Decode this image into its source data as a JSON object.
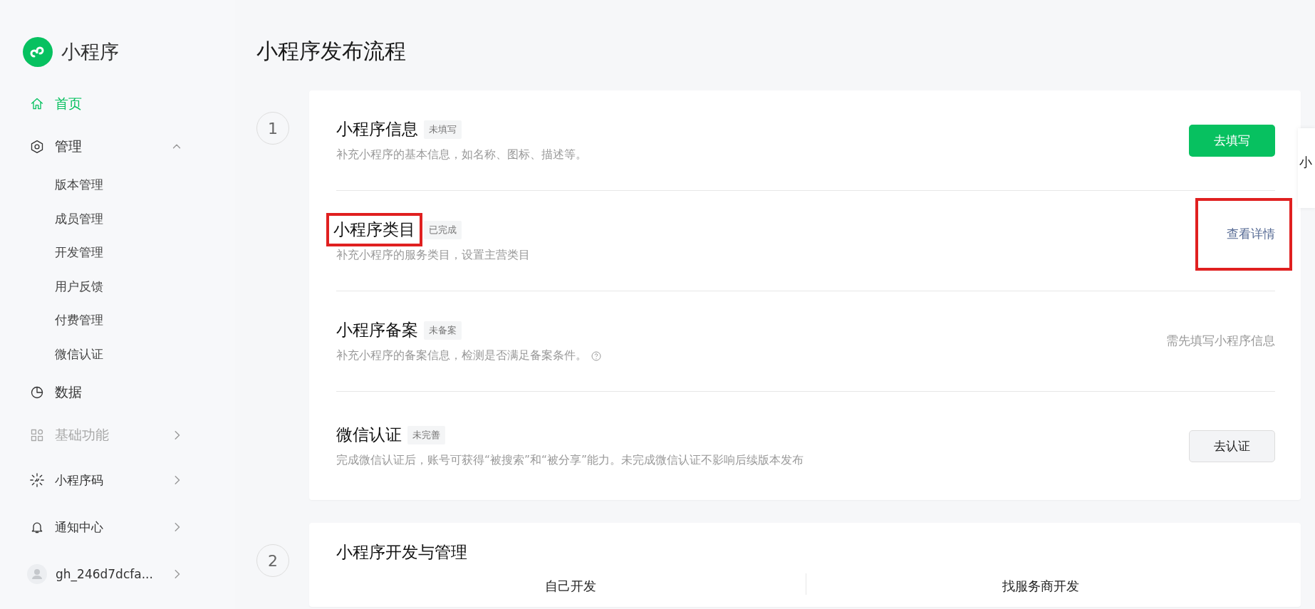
{
  "sidebar": {
    "logo": {
      "text": "小程序"
    },
    "items": [
      {
        "label": "首页",
        "selected": true
      },
      {
        "label": "管理",
        "selected": false,
        "expanded": true,
        "children": [
          {
            "label": "版本管理",
            "selected": false
          },
          {
            "label": "成员管理",
            "selected": false
          },
          {
            "label": "开发管理",
            "selected": false
          },
          {
            "label": "用户反馈",
            "selected": false
          },
          {
            "label": "付费管理",
            "selected": false
          },
          {
            "label": "微信认证",
            "selected": false
          }
        ]
      },
      {
        "label": "数据",
        "selected": false
      },
      {
        "label": "基础功能",
        "selected": false,
        "expanded": false,
        "disabled": true
      },
      {
        "label": "小程序码",
        "selected": false,
        "expanded": false
      },
      {
        "label": "通知中心",
        "selected": false,
        "expanded": false
      },
      {
        "label": "gh_246d7dcfa...",
        "selected": false,
        "expanded": false,
        "kind": "account"
      }
    ]
  },
  "page_title": "小程序发布流程",
  "steps": [
    {
      "number": "1",
      "items": [
        {
          "title": "小程序信息",
          "status": "未填写",
          "description": "补充小程序的基本信息，如名称、图标、描述等。",
          "action": {
            "kind": "primary",
            "label": "去填写"
          }
        },
        {
          "title": "小程序类目",
          "status": "已完成",
          "description": "补充小程序的服务类目，设置主营类目",
          "title_highlighted": true,
          "action": {
            "kind": "link",
            "label": "查看详情",
            "highlighted": true
          }
        },
        {
          "title": "小程序备案",
          "status": "未备案",
          "description": "补充小程序的备案信息，检测是否满足备案条件。",
          "help": true,
          "action": {
            "kind": "note",
            "label": "需先填写小程序信息"
          }
        },
        {
          "title": "微信认证",
          "status": "未完善",
          "description": "完成微信认证后，账号可获得“被搜索”和“被分享”能力。未完成微信认证不影响后续版本发布",
          "action": {
            "kind": "default",
            "label": "去认证"
          }
        }
      ]
    },
    {
      "number": "2",
      "title": "小程序开发与管理",
      "options": [
        "自己开发",
        "找服务商开发"
      ]
    }
  ],
  "side_popup": {
    "text": "小"
  }
}
